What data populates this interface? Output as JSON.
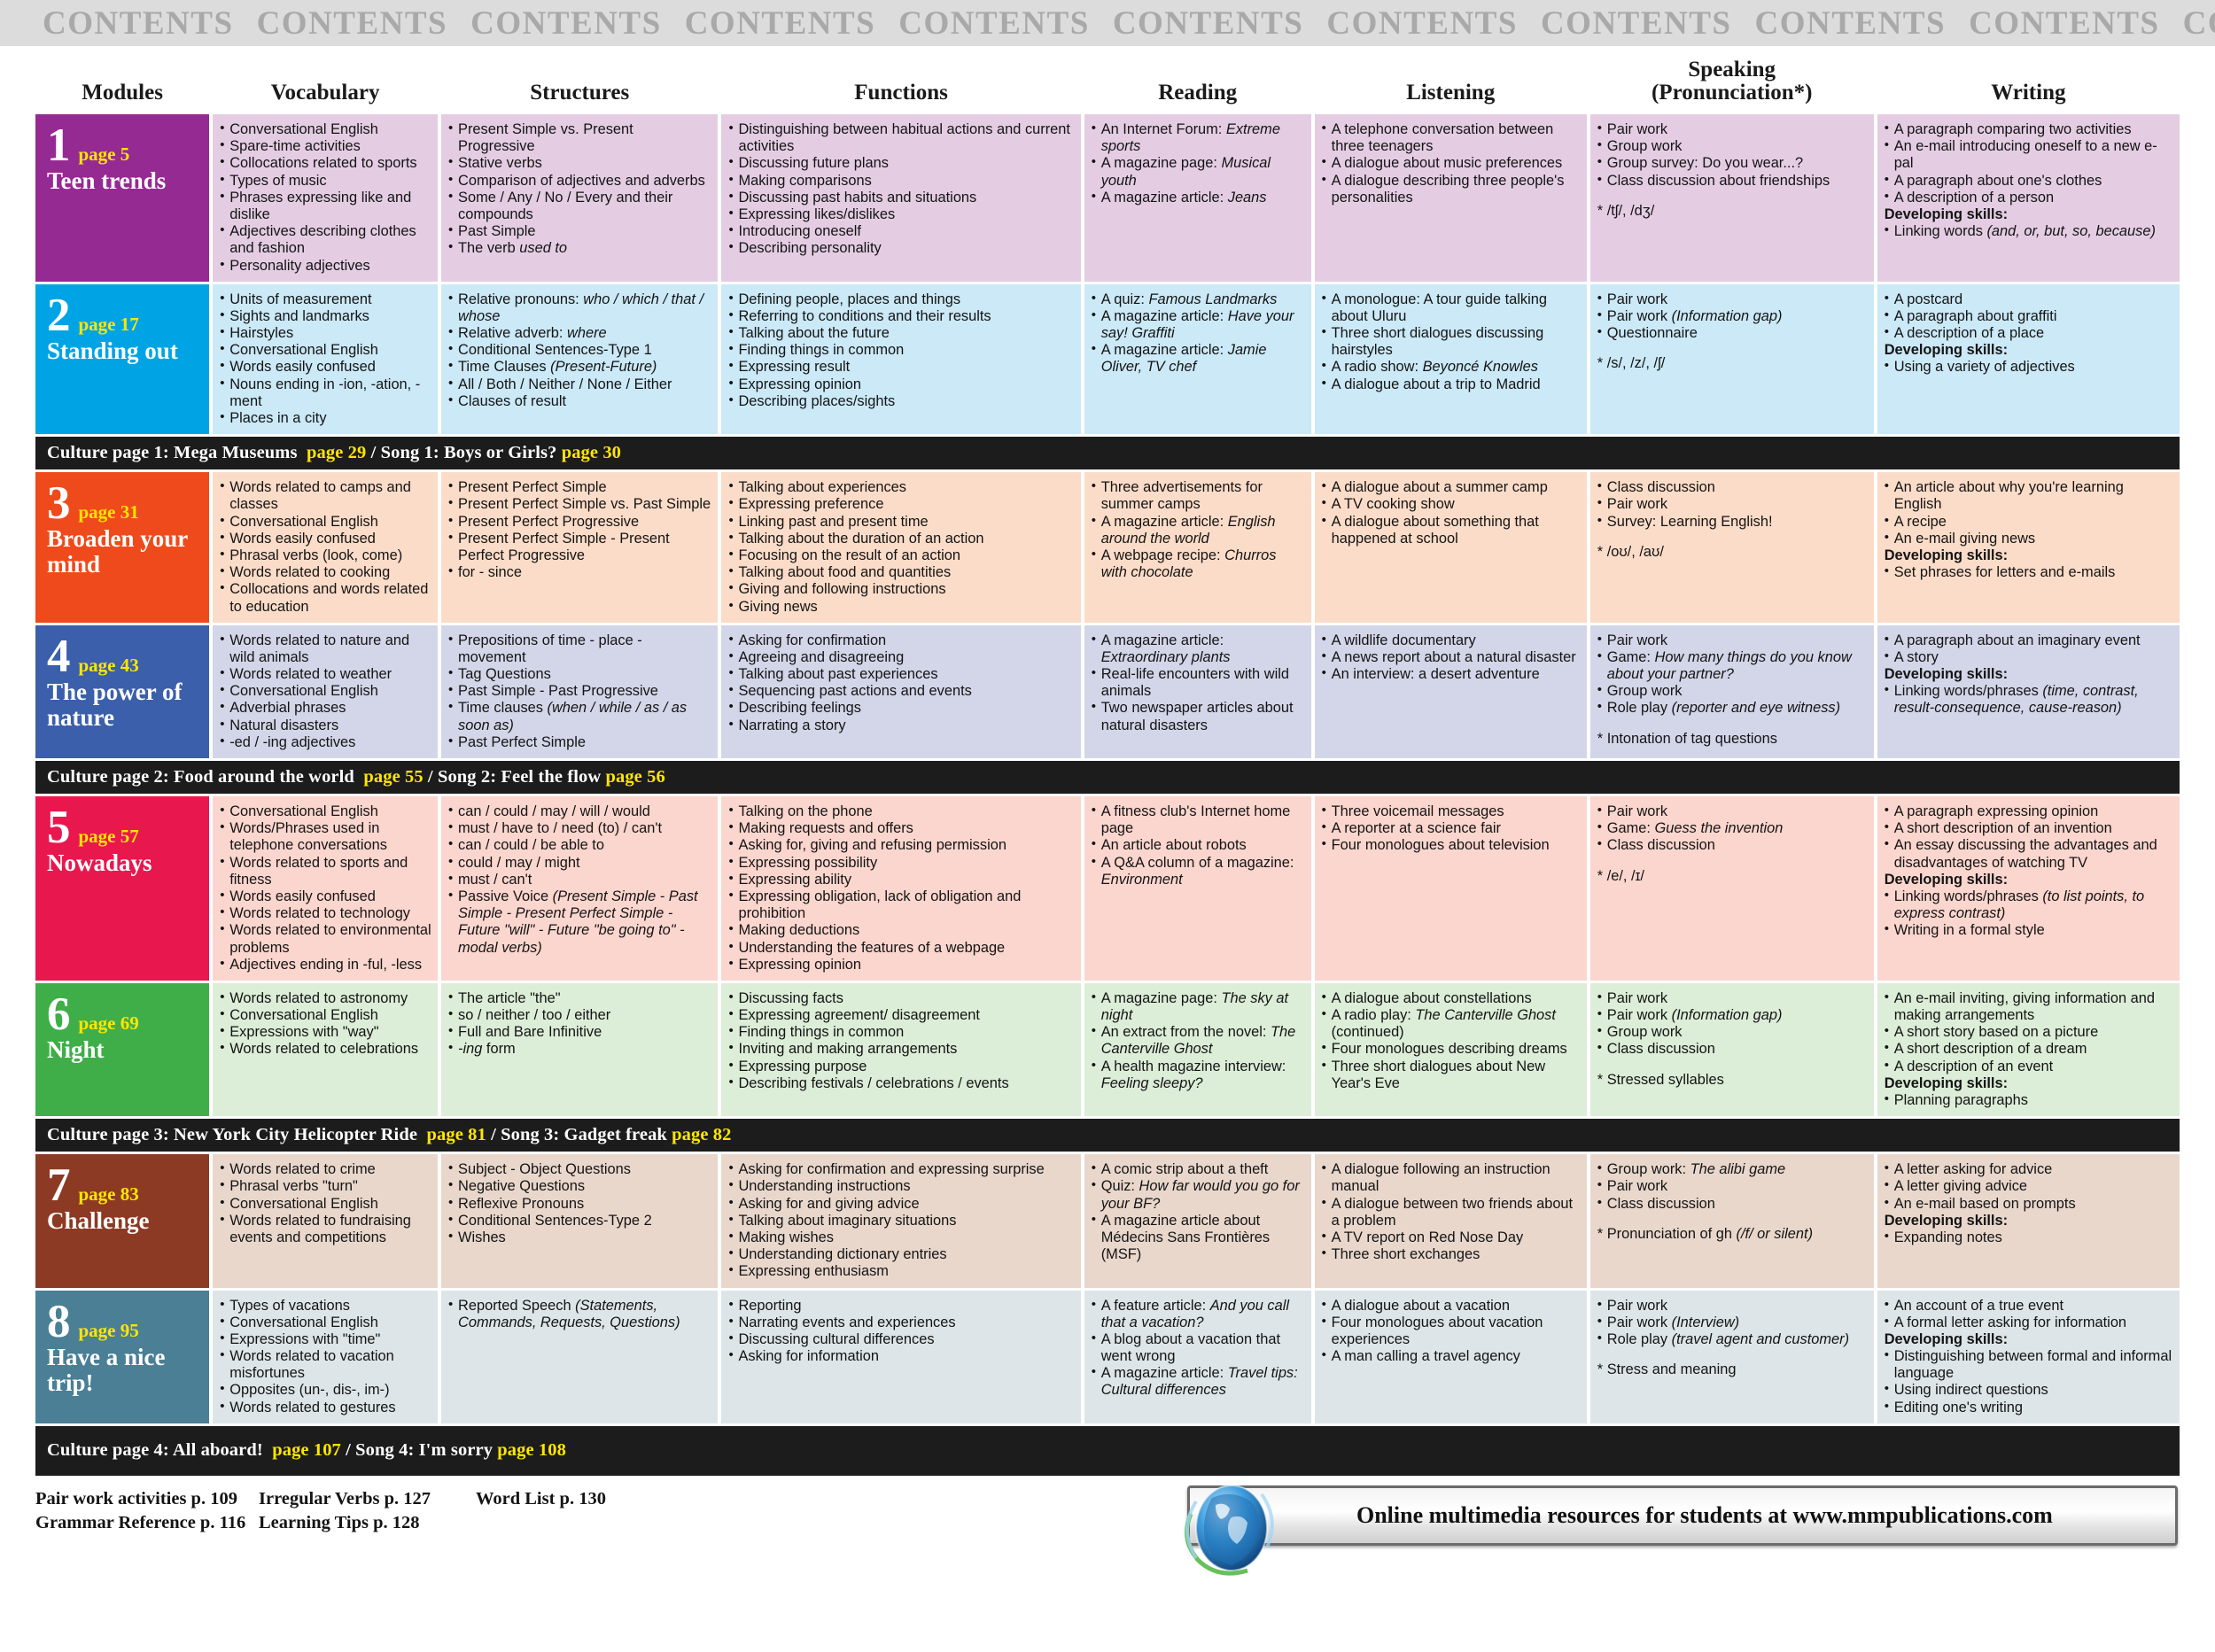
{
  "contents_band": {
    "word": "CONTENTS",
    "repeat": 11
  },
  "columns": [
    {
      "key": "modules",
      "label": "Modules"
    },
    {
      "key": "vocabulary",
      "label": "Vocabulary"
    },
    {
      "key": "structures",
      "label": "Structures"
    },
    {
      "key": "functions",
      "label": "Functions"
    },
    {
      "key": "reading",
      "label": "Reading"
    },
    {
      "key": "listening",
      "label": "Listening"
    },
    {
      "key": "speaking",
      "label": "Speaking\n(Pronunciation*)"
    },
    {
      "key": "writing",
      "label": "Writing"
    }
  ],
  "colors": {
    "band": "#dcdcdc",
    "band_text": "#a9a9a9",
    "page_yellow": "#ffe600",
    "culture_bar": "#1c1c1c",
    "m1_dark": "#952a93",
    "m1_light": "#e4cde3",
    "m2_dark": "#00a4e4",
    "m2_light": "#cbe9f7",
    "m3_dark": "#ef4a1b",
    "m3_light": "#fbdcc8",
    "m4_dark": "#3b5faa",
    "m4_light": "#d2d6e8",
    "m5_dark": "#e8174e",
    "m5_light": "#fbd6ce",
    "m6_dark": "#3fae49",
    "m6_light": "#dcedd8",
    "m7_dark": "#8c3a24",
    "m7_light": "#e9d7cc",
    "m8_dark": "#4a7f95",
    "m8_light": "#dde5e8"
  },
  "modules": [
    {
      "number": "1",
      "page": "page 5",
      "title": "Teen trends",
      "dark": "#952a93",
      "light": "#e4cde3",
      "vocabulary": [
        "Conversational English",
        "Spare-time activities",
        "Collocations related to sports",
        "Types of music",
        "Phrases expressing like and dislike",
        "Adjectives describing clothes and fashion",
        "Personality adjectives"
      ],
      "structures": [
        "Present Simple vs. Present Progressive",
        "Stative verbs",
        "Comparison of adjectives and adverbs",
        "Some / Any / No / Every and their compounds",
        "Past Simple",
        "The verb <em>used to</em>"
      ],
      "functions": [
        "Distinguishing between habitual actions and current activities",
        "Discussing future plans",
        "Making comparisons",
        "Discussing past habits and situations",
        "Expressing likes/dislikes",
        "Introducing oneself",
        "Describing personality"
      ],
      "reading": [
        "An Internet Forum: <em>Extreme sports</em>",
        "A magazine page: <em>Musical youth</em>",
        "A magazine article: <em>Jeans</em>"
      ],
      "listening": [
        "A telephone conversation between three teenagers",
        "A dialogue about music preferences",
        "A dialogue describing three people's personalities"
      ],
      "speaking": [
        "Pair work",
        "Group work",
        "Group survey: Do you wear...?",
        "Class discussion about friendships"
      ],
      "pronunciation": "* /tʃ/, /dʒ/",
      "writing": [
        {
          "type": "bullet",
          "text": "A paragraph comparing two activities"
        },
        {
          "type": "bullet",
          "text": "An e-mail introducing oneself to a new e-pal"
        },
        {
          "type": "bullet",
          "text": "A paragraph about one's clothes"
        },
        {
          "type": "bullet",
          "text": "A description of a person"
        },
        {
          "type": "devskill",
          "text": "Developing skills:"
        },
        {
          "type": "bullet",
          "text": "Linking words <em>(and, or, but, so, because)</em>"
        }
      ]
    },
    {
      "number": "2",
      "page": "page 17",
      "title": "Standing out",
      "dark": "#00a4e4",
      "light": "#cbe9f7",
      "vocabulary": [
        "Units of measurement",
        "Sights and landmarks",
        "Hairstyles",
        "Conversational English",
        "Words easily confused",
        "Nouns ending in -ion, -ation, -ment",
        "Places in a city"
      ],
      "structures": [
        "Relative pronouns: <em>who / which / that / whose</em>",
        "Relative adverb: <em>where</em>",
        "Conditional Sentences-Type 1",
        "Time Clauses <em>(Present-Future)</em>",
        "All / Both / Neither / None / Either",
        "Clauses of result"
      ],
      "functions": [
        "Defining people, places and things",
        "Referring to conditions and their results",
        "Talking about the future",
        "Finding things in common",
        "Expressing result",
        "Expressing opinion",
        "Describing places/sights"
      ],
      "reading": [
        "A quiz: <em>Famous Landmarks</em>",
        "A magazine article: <em>Have your say! Graffiti</em>",
        "A magazine article: <em>Jamie Oliver, TV chef</em>"
      ],
      "listening": [
        "A monologue: A tour guide talking about Uluru",
        "Three short dialogues discussing hairstyles",
        "A radio show: <em>Beyoncé Knowles</em>",
        "A dialogue about a trip to Madrid"
      ],
      "speaking": [
        "Pair work",
        "Pair work <em>(Information gap)</em>",
        "Questionnaire"
      ],
      "pronunciation": "* /s/, /z/, /ʃ/",
      "writing": [
        {
          "type": "bullet",
          "text": "A postcard"
        },
        {
          "type": "bullet",
          "text": "A paragraph about graffiti"
        },
        {
          "type": "bullet",
          "text": "A description of a place"
        },
        {
          "type": "devskill",
          "text": "Developing skills:"
        },
        {
          "type": "bullet",
          "text": "Using a variety of adjectives"
        }
      ]
    },
    {
      "number": "3",
      "page": "page 31",
      "title": "Broaden your mind",
      "dark": "#ef4a1b",
      "light": "#fbdcc8",
      "vocabulary": [
        "Words related to camps and classes",
        "Conversational English",
        "Words easily confused",
        "Phrasal verbs (look, come)",
        "Words related to cooking",
        "Collocations and words related to education"
      ],
      "structures": [
        "Present Perfect Simple",
        "Present Perfect Simple vs. Past Simple",
        "Present Perfect Progressive",
        "Present Perfect Simple - Present Perfect Progressive",
        "for - since"
      ],
      "functions": [
        "Talking about experiences",
        "Expressing preference",
        "Linking past and present time",
        "Talking about the duration of an action",
        "Focusing on the result of an action",
        "Talking about food and quantities",
        "Giving and following instructions",
        "Giving news"
      ],
      "reading": [
        "Three advertisements for summer camps",
        "A magazine article: <em>English around the world</em>",
        "A webpage recipe: <em>Churros with chocolate</em>"
      ],
      "listening": [
        "A dialogue about a summer camp",
        "A TV cooking show",
        "A dialogue about something that happened at school"
      ],
      "speaking": [
        "Class discussion",
        "Pair work",
        "Survey: Learning English!"
      ],
      "pronunciation": "* /oʊ/, /aʊ/",
      "writing": [
        {
          "type": "bullet",
          "text": "An article about why you're learning English"
        },
        {
          "type": "bullet",
          "text": "A recipe"
        },
        {
          "type": "bullet",
          "text": "An e-mail giving news"
        },
        {
          "type": "devskill",
          "text": "Developing skills:"
        },
        {
          "type": "bullet",
          "text": "Set phrases for letters and e-mails"
        }
      ]
    },
    {
      "number": "4",
      "page": "page 43",
      "title": "The power of nature",
      "dark": "#3b5faa",
      "light": "#d2d6e8",
      "vocabulary": [
        "Words related to nature and wild animals",
        "Words related to weather",
        "Conversational English",
        "Adverbial phrases",
        "Natural disasters",
        "-ed / -ing adjectives"
      ],
      "structures": [
        "Prepositions of time - place - movement",
        "Tag Questions",
        "Past Simple - Past Progressive",
        "Time clauses <em>(when / while / as / as soon as)</em>",
        "Past Perfect Simple"
      ],
      "functions": [
        "Asking for confirmation",
        "Agreeing and disagreeing",
        "Talking about past experiences",
        "Sequencing past actions and events",
        "Describing feelings",
        "Narrating a story"
      ],
      "reading": [
        "A magazine article: <em>Extraordinary plants</em>",
        "Real-life encounters with wild animals",
        "Two newspaper articles about natural disasters"
      ],
      "listening": [
        "A wildlife documentary",
        "A news report about a natural disaster",
        "An interview: a desert adventure"
      ],
      "speaking": [
        "Pair work",
        "Game: <em>How many things do you know about your partner?</em>",
        "Group work",
        "Role play <em>(reporter and eye witness)</em>"
      ],
      "pronunciation": "* Intonation of tag questions",
      "writing": [
        {
          "type": "bullet",
          "text": "A paragraph about an imaginary event"
        },
        {
          "type": "bullet",
          "text": "A story"
        },
        {
          "type": "devskill",
          "text": "Developing skills:"
        },
        {
          "type": "bullet",
          "text": "Linking words/phrases <em>(time, contrast, result-consequence, cause-reason)</em>"
        }
      ]
    },
    {
      "number": "5",
      "page": "page 57",
      "title": "Nowadays",
      "dark": "#e8174e",
      "light": "#fbd6ce",
      "vocabulary": [
        "Conversational English",
        "Words/Phrases used in telephone conversations",
        "Words related to sports and fitness",
        "Words easily confused",
        "Words related to technology",
        "Words related to environmental problems",
        "Adjectives ending in -ful, -less"
      ],
      "structures": [
        "can / could / may / will / would",
        "must / have to / need (to) / can't",
        "can / could / be able to",
        "could / may / might",
        "must / can't",
        "Passive Voice <em>(Present Simple - Past Simple - Present Perfect Simple - Future \"will\" - Future \"be going to\" - modal verbs)</em>"
      ],
      "functions": [
        "Talking on the phone",
        "Making requests and offers",
        "Asking for, giving and refusing permission",
        "Expressing possibility",
        "Expressing ability",
        "Expressing obligation, lack of obligation and prohibition",
        "Making deductions",
        "Understanding the features of a webpage",
        "Expressing opinion"
      ],
      "reading": [
        "A fitness club's Internet home page",
        "An article about robots",
        "A Q&A column of a magazine: <em>Environment</em>"
      ],
      "listening": [
        "Three voicemail messages",
        "A reporter at a science fair",
        "Four monologues about television"
      ],
      "speaking": [
        "Pair work",
        "Game: <em>Guess the invention</em>",
        "Class discussion"
      ],
      "pronunciation": "* /e/, /ɪ/",
      "writing": [
        {
          "type": "bullet",
          "text": "A paragraph expressing opinion"
        },
        {
          "type": "bullet",
          "text": "A short description of an invention"
        },
        {
          "type": "bullet",
          "text": "An essay discussing the advantages and disadvantages of watching TV"
        },
        {
          "type": "devskill",
          "text": "Developing skills:"
        },
        {
          "type": "bullet",
          "text": "Linking words/phrases <em>(to list points, to express contrast)</em>"
        },
        {
          "type": "bullet",
          "text": "Writing in a formal style"
        }
      ]
    },
    {
      "number": "6",
      "page": "page 69",
      "title": "Night",
      "dark": "#3fae49",
      "light": "#dcedd8",
      "vocabulary": [
        "Words related to astronomy",
        "Conversational English",
        "Expressions with \"way\"",
        "Words related to celebrations"
      ],
      "structures": [
        "The article \"the\"",
        "so / neither / too / either",
        "Full and Bare Infinitive",
        "<em>-ing</em> form"
      ],
      "functions": [
        "Discussing facts",
        "Expressing agreement/ disagreement",
        "Finding things in common",
        "Inviting and making arrangements",
        "Expressing purpose",
        "Describing festivals / celebrations / events"
      ],
      "reading": [
        "A magazine page: <em>The sky at night</em>",
        "An extract from the novel: <em>The Canterville Ghost</em>",
        "A health magazine interview: <em>Feeling sleepy?</em>"
      ],
      "listening": [
        "A dialogue about constellations",
        "A radio play: <em>The Canterville Ghost</em> (continued)",
        "Four monologues describing dreams",
        "Three short dialogues about New Year's Eve"
      ],
      "speaking": [
        "Pair work",
        "Pair work <em>(Information gap)</em>",
        "Group work",
        "Class discussion"
      ],
      "pronunciation": "* Stressed syllables",
      "writing": [
        {
          "type": "bullet",
          "text": "An e-mail inviting, giving information and making arrangements"
        },
        {
          "type": "bullet",
          "text": "A short story based on a picture"
        },
        {
          "type": "bullet",
          "text": "A short description of a dream"
        },
        {
          "type": "bullet",
          "text": "A description of an event"
        },
        {
          "type": "devskill",
          "text": "Developing skills:"
        },
        {
          "type": "bullet",
          "text": "Planning paragraphs"
        }
      ]
    },
    {
      "number": "7",
      "page": "page 83",
      "title": "Challenge",
      "dark": "#8c3a24",
      "light": "#e9d7cc",
      "vocabulary": [
        "Words related to crime",
        "Phrasal verbs \"turn\"",
        "Conversational English",
        "Words related to fundraising events and competitions"
      ],
      "structures": [
        "Subject - Object Questions",
        "Negative Questions",
        "Reflexive Pronouns",
        "Conditional Sentences-Type 2",
        "Wishes"
      ],
      "functions": [
        "Asking for confirmation and expressing surprise",
        "Understanding instructions",
        "Asking for and giving advice",
        "Talking about imaginary situations",
        "Making wishes",
        "Understanding dictionary entries",
        "Expressing enthusiasm"
      ],
      "reading": [
        "A comic strip about a theft",
        "Quiz: <em>How far would you go for your BF?</em>",
        "A magazine article about Médecins Sans Frontières (MSF)"
      ],
      "listening": [
        "A dialogue following an instruction manual",
        "A dialogue between two friends about a problem",
        "A TV report on Red Nose Day",
        "Three short exchanges"
      ],
      "speaking": [
        "Group work: <em>The alibi game</em>",
        "Pair work",
        "Class discussion"
      ],
      "pronunciation": "* Pronunciation of gh <em>(/f/ or silent)</em>",
      "writing": [
        {
          "type": "bullet",
          "text": "A letter asking for advice"
        },
        {
          "type": "bullet",
          "text": "A letter giving advice"
        },
        {
          "type": "bullet",
          "text": "An e-mail based on prompts"
        },
        {
          "type": "devskill",
          "text": "Developing skills:"
        },
        {
          "type": "bullet",
          "text": "Expanding notes"
        }
      ]
    },
    {
      "number": "8",
      "page": "page 95",
      "title": "Have a nice trip!",
      "dark": "#4a7f95",
      "light": "#dde5e8",
      "vocabulary": [
        "Types of vacations",
        "Conversational English",
        "Expressions with \"time\"",
        "Words related to vacation misfortunes",
        "Opposites (un-, dis-, im-)",
        "Words related to gestures"
      ],
      "structures": [
        "Reported Speech <em>(Statements, Commands, Requests, Questions)</em>"
      ],
      "functions": [
        "Reporting",
        "Narrating events and experiences",
        "Discussing cultural differences",
        "Asking for information"
      ],
      "reading": [
        "A feature article: <em>And you call that a vacation?</em>",
        "A blog about a vacation that went wrong",
        "A magazine article: <em>Travel tips: Cultural differences</em>"
      ],
      "listening": [
        "A dialogue about a vacation",
        "Four monologues about vacation experiences",
        "A man calling a travel agency"
      ],
      "speaking": [
        "Pair work",
        "Pair work <em>(Interview)</em>",
        "Role play <em>(travel agent and customer)</em>"
      ],
      "pronunciation": "* Stress and meaning",
      "writing": [
        {
          "type": "bullet",
          "text": "An account of a true event"
        },
        {
          "type": "bullet",
          "text": "A formal letter asking for information"
        },
        {
          "type": "devskill",
          "text": "Developing skills:"
        },
        {
          "type": "bullet",
          "text": "Distinguishing between formal and informal language"
        },
        {
          "type": "bullet",
          "text": "Using indirect questions"
        },
        {
          "type": "bullet",
          "text": "Editing one's writing"
        }
      ]
    }
  ],
  "culture_bars": [
    {
      "after_module": 2,
      "text_pre": "Culture page 1: Mega Museums",
      "page1": "page 29",
      "mid": " / Song 1: Boys or Girls? ",
      "page2": "page 30"
    },
    {
      "after_module": 4,
      "text_pre": "Culture page 2: Food around the world",
      "page1": "page 55",
      "mid": " / Song 2: Feel the flow ",
      "page2": "page 56"
    },
    {
      "after_module": 6,
      "text_pre": "Culture page 3: New York City Helicopter Ride",
      "page1": "page 81",
      "mid": " / Song 3: Gadget freak ",
      "page2": "page 82"
    },
    {
      "after_module": 8,
      "text_pre": "Culture page 4: All aboard!",
      "page1": "page 107",
      "mid": " / Song 4: I'm sorry ",
      "page2": "page 108"
    }
  ],
  "footer": {
    "col1": [
      "Pair work activities p. 109",
      "Grammar Reference p. 116"
    ],
    "col2": [
      "Irregular Verbs p. 127",
      "Learning Tips p. 128"
    ],
    "col3": [
      "Word List  p. 130"
    ],
    "banner_text": "Online multimedia resources for students at www.mmpublications.com",
    "globe_icon": "globe-icon"
  }
}
